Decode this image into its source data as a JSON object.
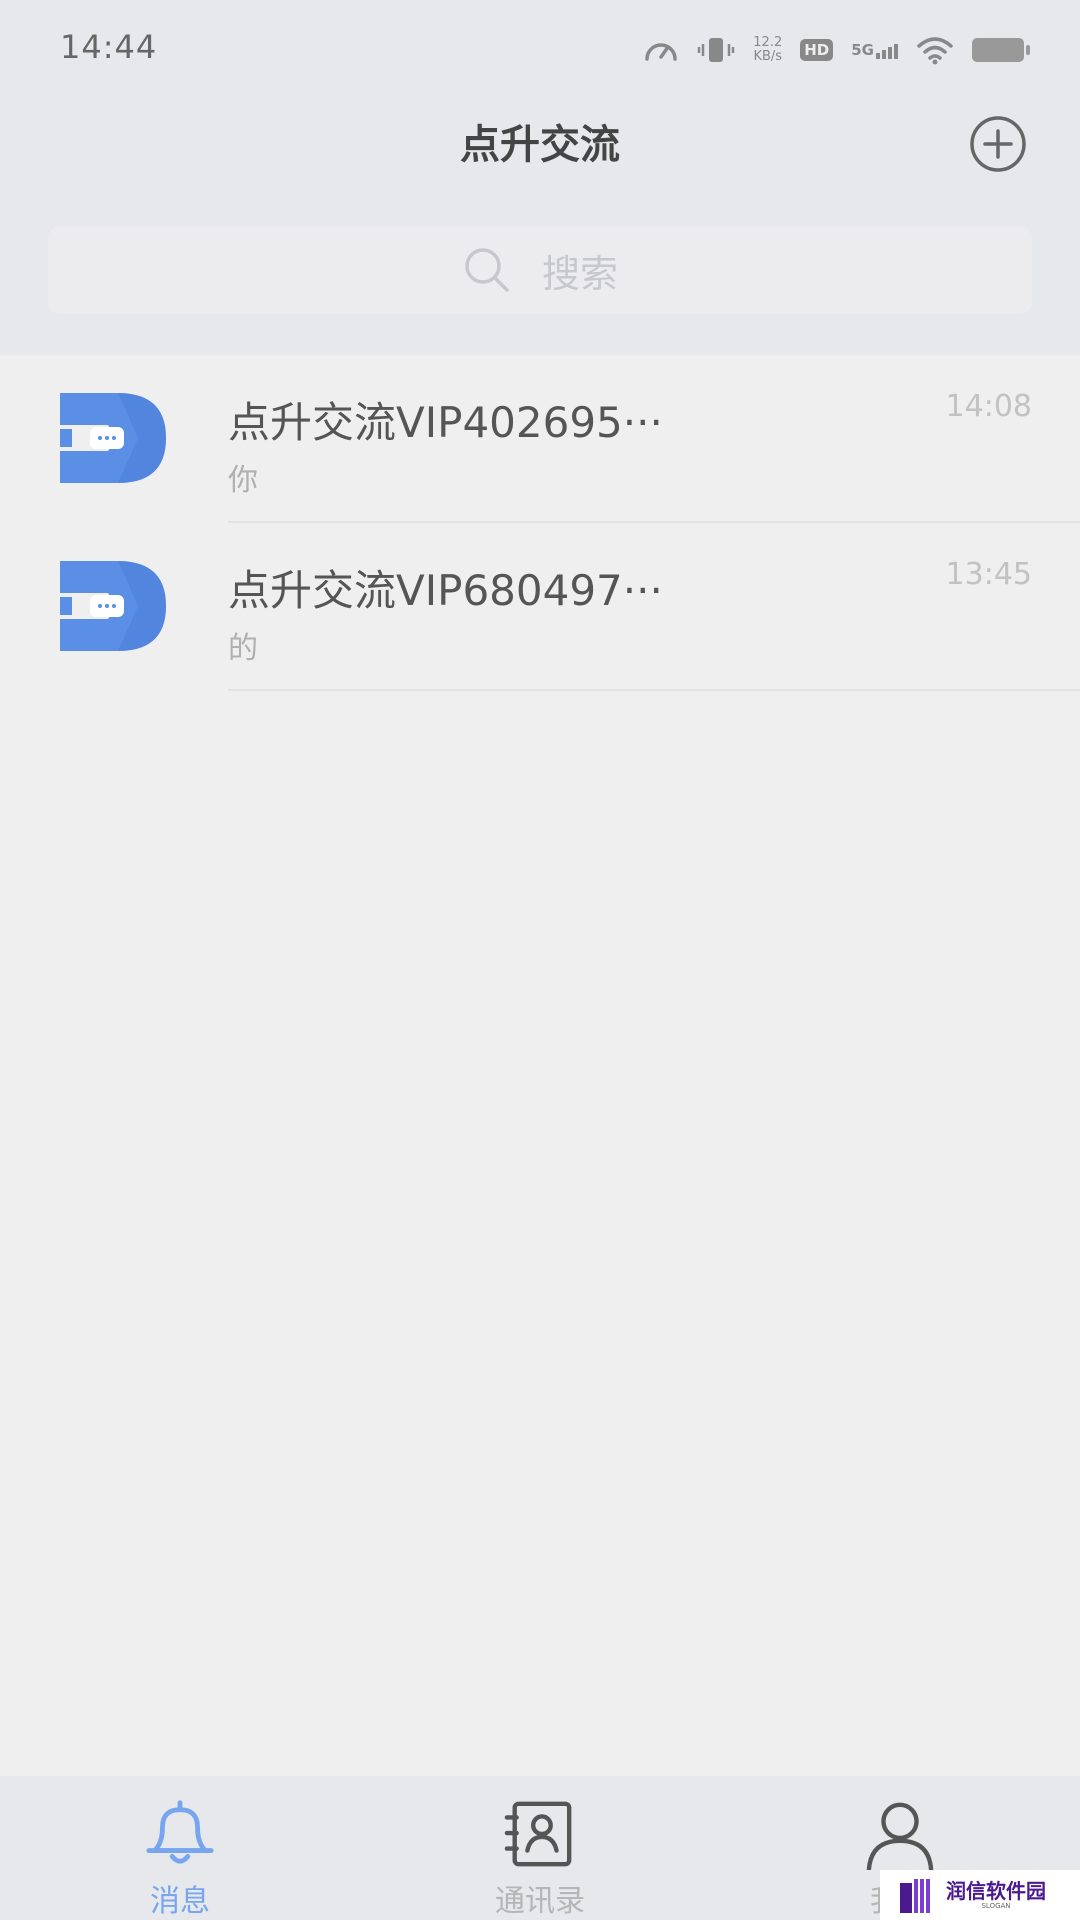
{
  "status_bar": {
    "time": "14:44",
    "net_speed_value": "12.2",
    "net_speed_unit": "KB/s",
    "hd_label": "HD",
    "network_label": "5G"
  },
  "header": {
    "title": "点升交流"
  },
  "search": {
    "placeholder": "搜索"
  },
  "conversations": [
    {
      "name": "点升交流VIP402695···",
      "preview": "你",
      "time": "14:08"
    },
    {
      "name": "点升交流VIP680497···",
      "preview": "的",
      "time": "13:45"
    }
  ],
  "tabs": [
    {
      "label": "消息",
      "icon": "bell-icon",
      "active": true
    },
    {
      "label": "通讯录",
      "icon": "contacts-icon",
      "active": false
    },
    {
      "label": "我的",
      "icon": "person-icon",
      "active": false
    }
  ],
  "watermark": {
    "text": "润信软件园",
    "sub": "SLOGAN"
  },
  "colors": {
    "accent": "#78a6ee",
    "avatar_blue": "#5b8fe6",
    "header_bg": "#e6e8ec",
    "page_bg": "#efefef"
  }
}
